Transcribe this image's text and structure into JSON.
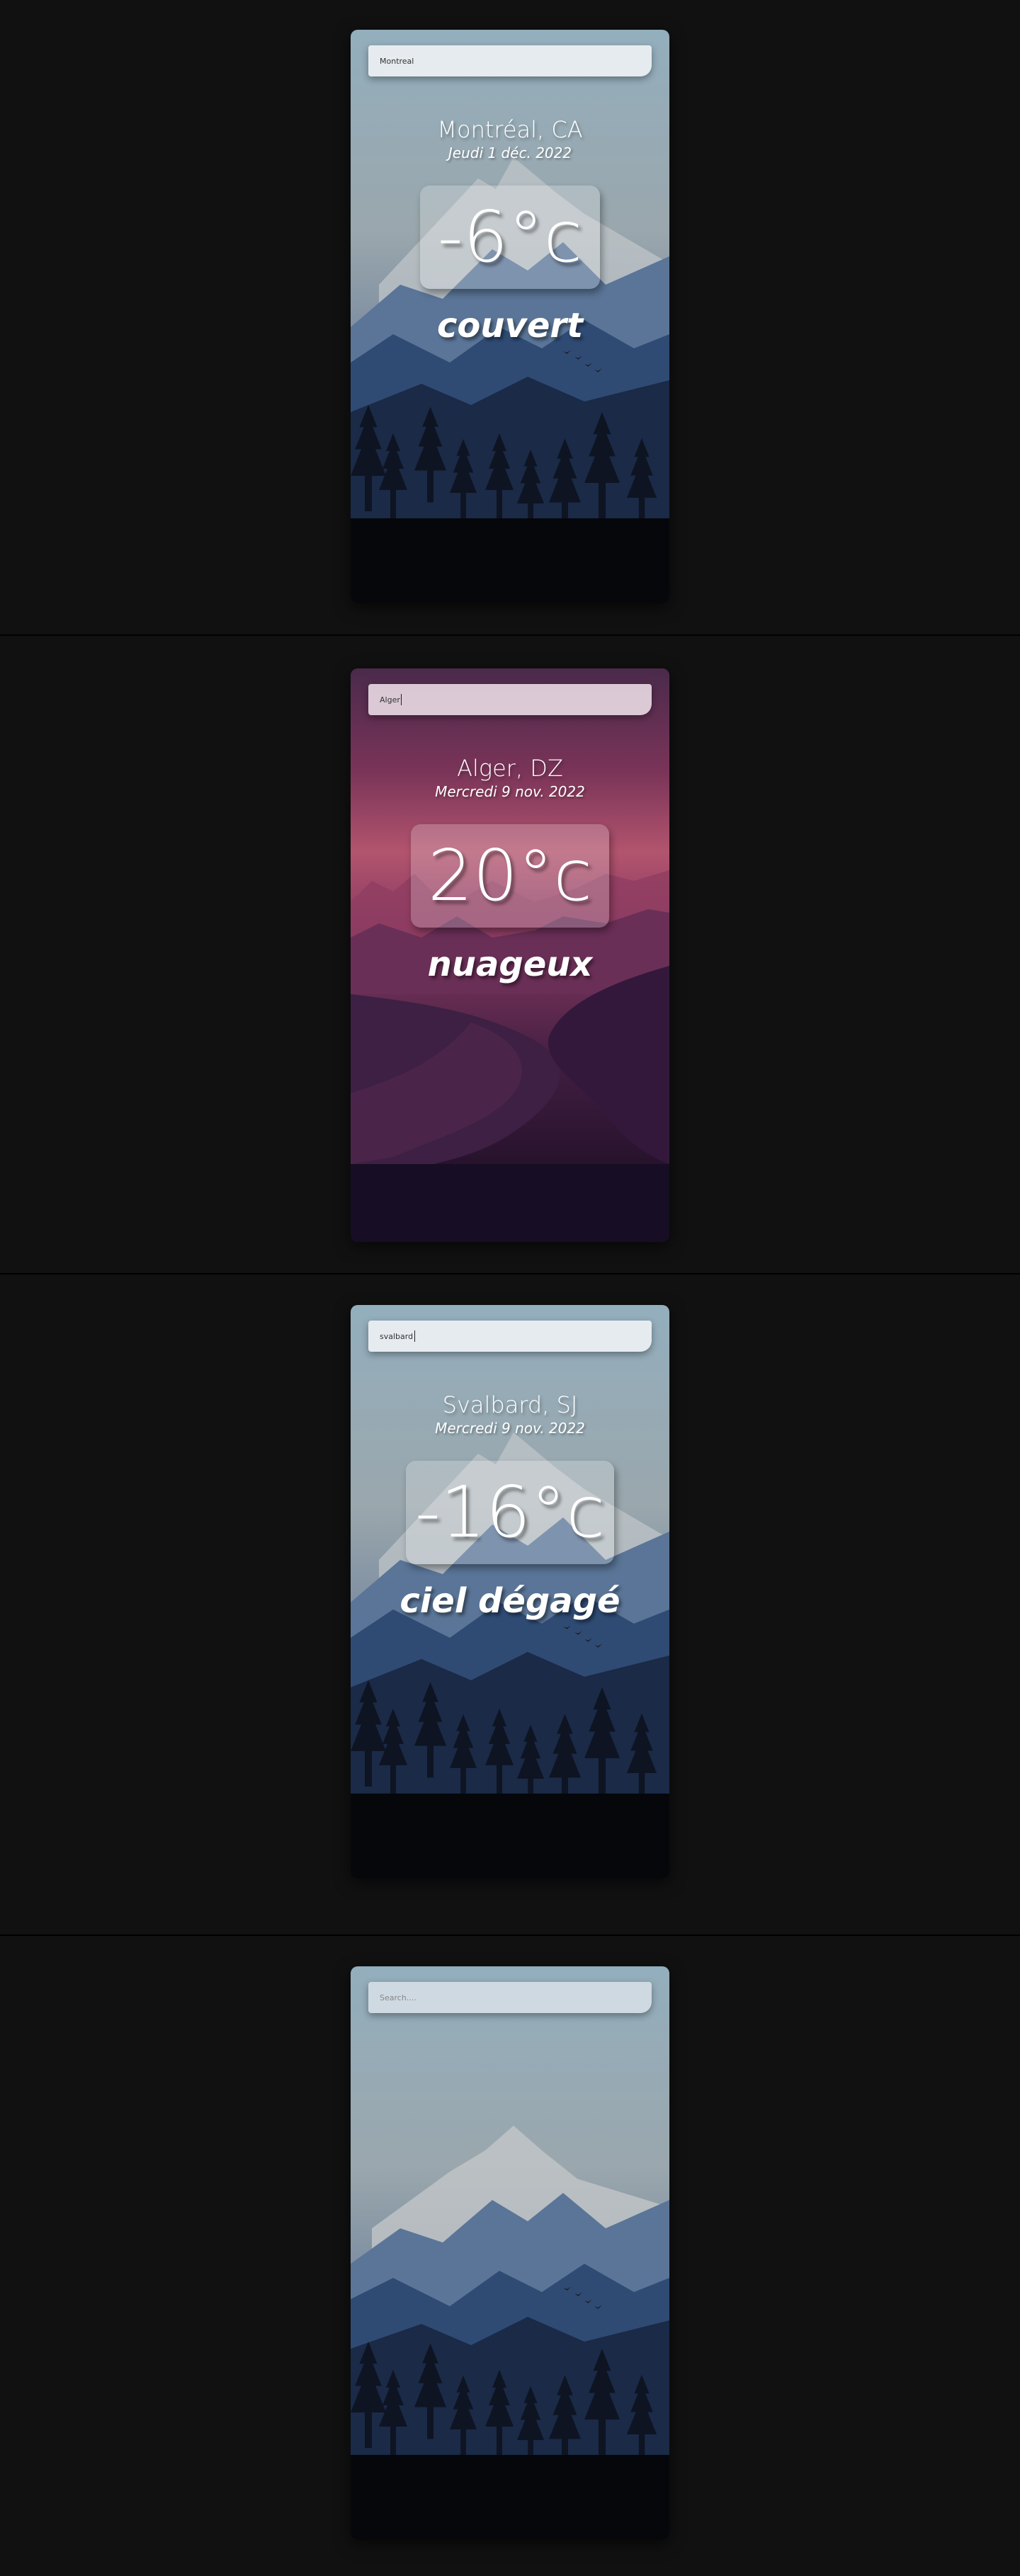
{
  "colors": {
    "page_background": "#111111",
    "separator": "#000000",
    "text": "#ffffff",
    "cool_sky_top": "#93aebd",
    "dusk_sky_top": "#4a2a4c",
    "dusk_sky_glow": "#b2546e"
  },
  "cards": [
    {
      "theme": "winter-forest",
      "search": {
        "value": "Montreal",
        "placeholder": "Search...."
      },
      "city": "Montréal, CA",
      "date": "Jeudi 1 déc. 2022",
      "temperature": "-6°c",
      "weather": "couvert"
    },
    {
      "theme": "dusk-lake",
      "search": {
        "value": "Alger",
        "placeholder": "Search...."
      },
      "city": "Alger, DZ",
      "date": "Mercredi 9 nov. 2022",
      "temperature": "20°c",
      "weather": "nuageux"
    },
    {
      "theme": "winter-forest",
      "search": {
        "value": "svalbard",
        "placeholder": "Search...."
      },
      "city": "Svalbard, SJ",
      "date": "Mercredi 9 nov. 2022",
      "temperature": "-16°c",
      "weather": "ciel dégagé"
    },
    {
      "theme": "winter-forest",
      "search": {
        "value": "",
        "placeholder": "Search...."
      }
    }
  ]
}
